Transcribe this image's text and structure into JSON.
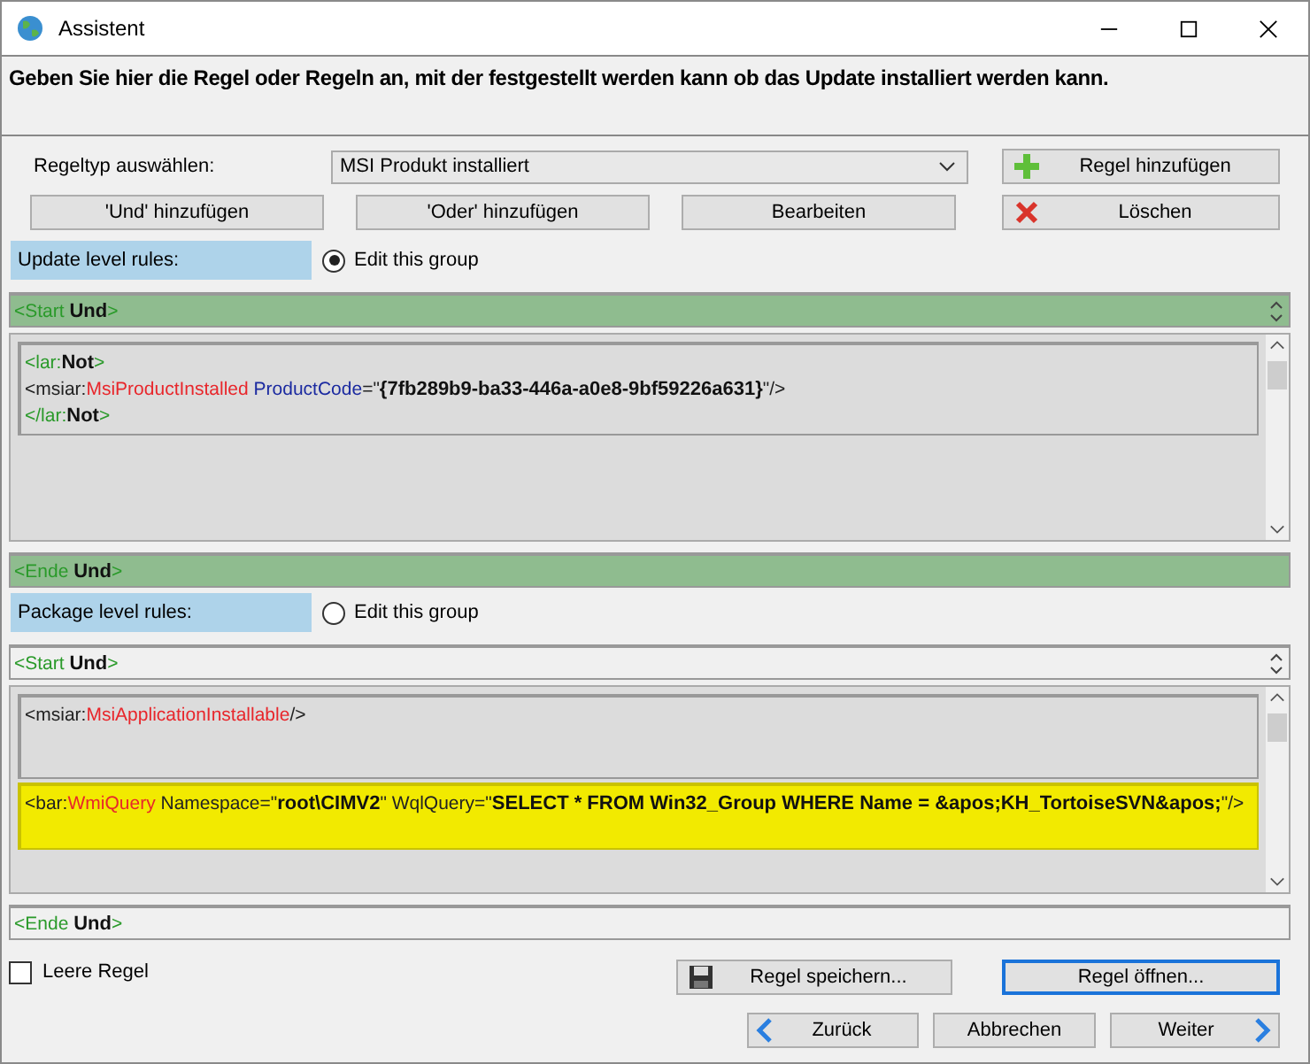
{
  "window": {
    "title": "Assistent"
  },
  "instruction": "Geben Sie hier die Regel oder Regeln an, mit der festgestellt werden kann ob das Update installiert werden kann.",
  "rule_type": {
    "label": "Regeltyp auswählen:",
    "value": "MSI Produkt installiert"
  },
  "add_rule_button": "Regel hinzufügen",
  "toolbar_buttons": [
    "'Und' hinzufügen",
    "'Oder' hinzufügen",
    "Bearbeiten"
  ],
  "delete_button": "Löschen",
  "groups": [
    {
      "label": "Update level rules:",
      "radio": "Edit this group",
      "selected": true,
      "start": [
        {
          "kind": "markup",
          "text": "<Start "
        },
        {
          "kind": "value",
          "text": "Und"
        },
        {
          "kind": "markup",
          "text": ">"
        }
      ],
      "rules": [
        {
          "highlighted": false,
          "lines": [
            [
              {
                "kind": "markup",
                "text": "<lar:"
              },
              {
                "kind": "value",
                "text": "Not"
              },
              {
                "kind": "markup",
                "text": ">"
              }
            ],
            [
              {
                "kind": "plain",
                "text": "<msiar:"
              },
              {
                "kind": "element",
                "text": "MsiProductInstalled"
              },
              {
                "kind": "attr",
                "text": " ProductCode"
              },
              {
                "kind": "plain",
                "text": "=\""
              },
              {
                "kind": "value",
                "text": "{7fb289b9-ba33-446a-a0e8-9bf59226a631}"
              },
              {
                "kind": "plain",
                "text": "\"/>"
              }
            ],
            [
              {
                "kind": "markup",
                "text": "</lar:"
              },
              {
                "kind": "value",
                "text": "Not"
              },
              {
                "kind": "markup",
                "text": ">"
              }
            ]
          ]
        }
      ],
      "end": [
        {
          "kind": "markup",
          "text": "<Ende "
        },
        {
          "kind": "value",
          "text": "Und"
        },
        {
          "kind": "markup",
          "text": ">"
        }
      ]
    },
    {
      "label": "Package level rules:",
      "radio": "Edit this group",
      "selected": false,
      "start": [
        {
          "kind": "markup",
          "text": "<Start "
        },
        {
          "kind": "value",
          "text": "Und"
        },
        {
          "kind": "markup",
          "text": ">"
        }
      ],
      "rules": [
        {
          "highlighted": false,
          "lines": [
            [
              {
                "kind": "plain",
                "text": "<msiar:"
              },
              {
                "kind": "element",
                "text": "MsiApplicationInstallable"
              },
              {
                "kind": "plain",
                "text": "/>"
              }
            ]
          ]
        },
        {
          "highlighted": true,
          "lines": [
            [
              {
                "kind": "plain",
                "text": "<bar:"
              },
              {
                "kind": "element",
                "text": "WmiQuery"
              },
              {
                "kind": "plain",
                "text": " Namespace=\""
              },
              {
                "kind": "value",
                "text": "root\\CIMV2"
              },
              {
                "kind": "plain",
                "text": "\" WqlQuery=\""
              },
              {
                "kind": "value",
                "text": "SELECT * FROM Win32_Group WHERE Name = &apos;KH_TortoiseSVN&apos;"
              },
              {
                "kind": "plain",
                "text": "\"/>"
              }
            ]
          ]
        }
      ],
      "end": [
        {
          "kind": "markup",
          "text": "<Ende "
        },
        {
          "kind": "value",
          "text": "Und"
        },
        {
          "kind": "markup",
          "text": ">"
        }
      ]
    }
  ],
  "empty_rule": {
    "label": "Leere Regel",
    "checked": false
  },
  "save_button": "Regel speichern...",
  "open_button": "Regel öffnen...",
  "nav_buttons": [
    {
      "kind": "back",
      "label": "Zurück"
    },
    {
      "kind": "cancel",
      "label": "Abbrechen"
    },
    {
      "kind": "next",
      "label": "Weiter"
    }
  ]
}
